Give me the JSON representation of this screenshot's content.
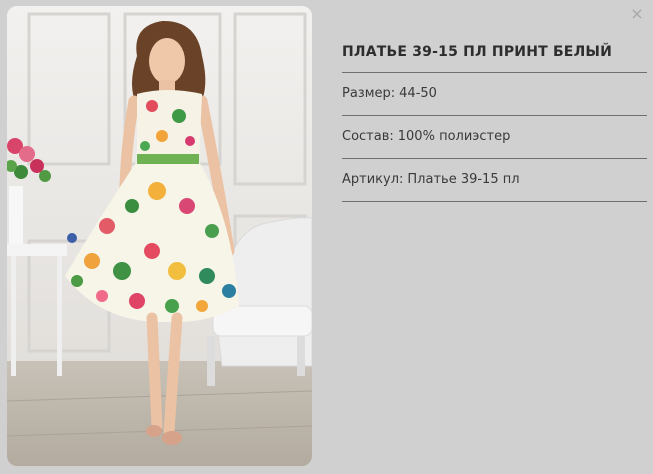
{
  "product": {
    "title": "ПЛАТЬЕ 39-15 ПЛ ПРИНТ БЕЛЫЙ",
    "image_alt_semantic": "dress-photo"
  },
  "details": [
    {
      "label": "Размер:",
      "value": "44-50"
    },
    {
      "label": "Состав:",
      "value": "100% полиэстер"
    },
    {
      "label": "Артикул:",
      "value": "Платье 39-15 пл"
    }
  ],
  "close_glyph": "×",
  "colors": {
    "background": "#d0d0d0",
    "divider": "#6f6f6f",
    "text": "#2d2d2d"
  }
}
